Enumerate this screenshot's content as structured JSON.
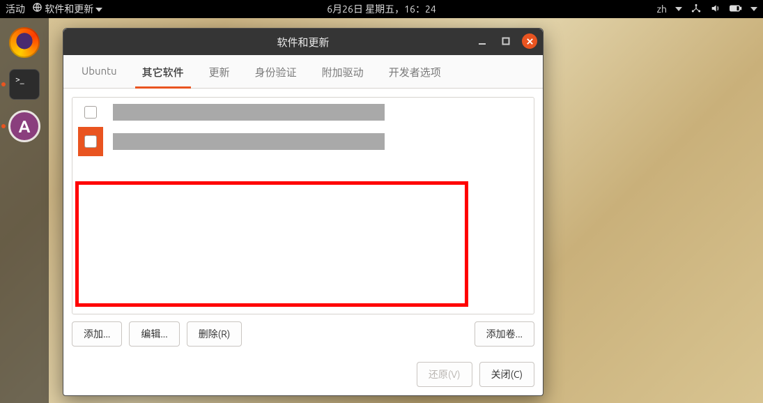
{
  "panel": {
    "activities": "活动",
    "app_menu": "软件和更新",
    "datetime": "6月26日 星期五，16：24",
    "input_method": "zh"
  },
  "dock": {
    "items": [
      {
        "name": "firefox",
        "running": false
      },
      {
        "name": "terminal",
        "running": true
      },
      {
        "name": "software-updater",
        "running": true
      }
    ]
  },
  "window": {
    "title": "软件和更新",
    "tabs": [
      "Ubuntu",
      "其它软件",
      "更新",
      "身份验证",
      "附加驱动",
      "开发者选项"
    ],
    "active_tab_index": 1,
    "sources": [
      {
        "checked": false,
        "selected": false,
        "label": ""
      },
      {
        "checked": false,
        "selected": true,
        "label": ""
      }
    ],
    "buttons": {
      "add": "添加...",
      "edit": "编辑...",
      "remove": "删除(R)",
      "add_volume": "添加卷...",
      "revert": "还原(V)",
      "close": "关闭(C)"
    }
  }
}
